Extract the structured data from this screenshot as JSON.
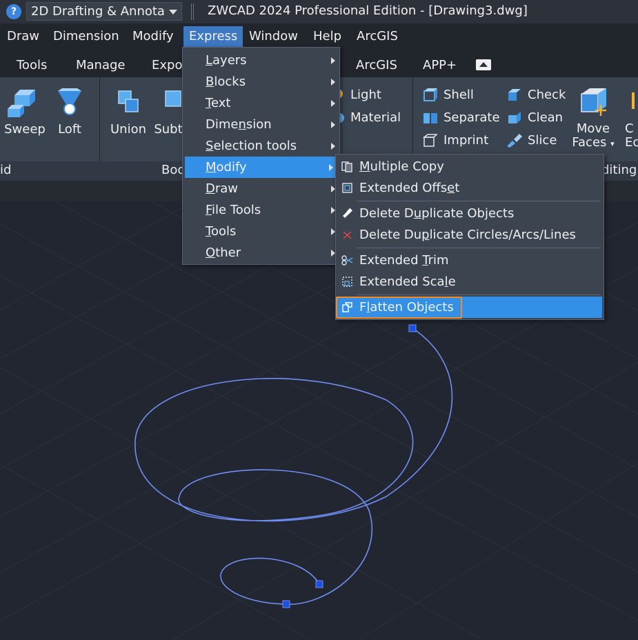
{
  "titlebar": {
    "help_icon": "question-icon",
    "workspace": "2D Drafting & Annota",
    "title": "ZWCAD 2024 Professional Edition - [Drawing3.dwg]"
  },
  "menubar": {
    "items": [
      "Draw",
      "Dimension",
      "Modify",
      "Express",
      "Window",
      "Help",
      "ArcGIS"
    ],
    "active": "Express"
  },
  "ribbon_tabs": [
    "Tools",
    "Manage",
    "Expor",
    "ArcGIS",
    "APP+"
  ],
  "ribbon": {
    "sweep": "Sweep",
    "loft": "Loft",
    "union": "Union",
    "subtract": "Subt",
    "light": "Light",
    "material": "Material",
    "shell": "Shell",
    "separate": "Separate",
    "imprint": "Imprint",
    "check": "Check",
    "clean": "Clean",
    "slice": "Slice",
    "move_faces_1": "Move",
    "move_faces_2": "Faces",
    "cut_top": "C",
    "cut_bottom": "Ec",
    "footer_solid": "id",
    "footer_bool": "Boo",
    "footer_editing": "diting"
  },
  "express_menu": {
    "items": [
      {
        "pre": "",
        "ul": "L",
        "post": "ayers"
      },
      {
        "pre": "",
        "ul": "B",
        "post": "locks"
      },
      {
        "pre": "",
        "ul": "T",
        "post": "ext"
      },
      {
        "pre": "Dime",
        "ul": "n",
        "post": "sion"
      },
      {
        "pre": "",
        "ul": "S",
        "post": "election tools"
      },
      {
        "pre": "",
        "ul": "M",
        "post": "odify"
      },
      {
        "pre": "",
        "ul": "D",
        "post": "raw"
      },
      {
        "pre": "",
        "ul": "F",
        "post": "ile Tools"
      },
      {
        "pre": "",
        "ul": "T",
        "post": "ools"
      },
      {
        "pre": "",
        "ul": "O",
        "post": "ther"
      }
    ],
    "highlighted": "Modify"
  },
  "modify_submenu": {
    "items": [
      {
        "pre": "",
        "ul": "M",
        "post": "ultiple Copy",
        "icon": "multiple-copy-icon"
      },
      {
        "pre": "Extended Offs",
        "ul": "e",
        "post": "t",
        "icon": "extended-offset-icon"
      },
      {
        "pre": "Delete D",
        "ul": "u",
        "post": "plicate Objects",
        "icon": "delete-duplicate-objects-icon"
      },
      {
        "pre": "Delete Du",
        "ul": "p",
        "post": "licate Circles/Arcs/Lines",
        "icon": "delete-duplicate-circles-icon"
      },
      {
        "pre": "Extended ",
        "ul": "T",
        "post": "rim",
        "icon": "extended-trim-icon"
      },
      {
        "pre": "Extended Sca",
        "ul": "l",
        "post": "e",
        "icon": "extended-scale-icon"
      },
      {
        "pre": "F",
        "ul": "l",
        "post": "atten Objects",
        "icon": "flatten-objects-icon"
      }
    ],
    "highlighted": "Flatten Objects"
  },
  "colors": {
    "accent": "#3390e6",
    "focus_outline": "#f08a24",
    "helix": "#6f8ff5",
    "grip": "#1f4fe0"
  }
}
